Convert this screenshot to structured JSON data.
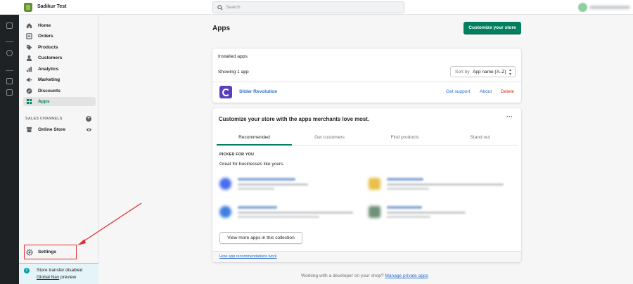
{
  "topbar": {
    "store_name": "Sadikur Test",
    "search_placeholder": "Search"
  },
  "sidebar": {
    "items": [
      {
        "label": "Home",
        "icon": "home-icon"
      },
      {
        "label": "Orders",
        "icon": "orders-icon"
      },
      {
        "label": "Products",
        "icon": "tag-icon"
      },
      {
        "label": "Customers",
        "icon": "person-icon"
      },
      {
        "label": "Analytics",
        "icon": "bar-chart-icon"
      },
      {
        "label": "Marketing",
        "icon": "megaphone-icon"
      },
      {
        "label": "Discounts",
        "icon": "discount-icon"
      },
      {
        "label": "Apps",
        "icon": "apps-icon",
        "active": true
      }
    ],
    "channels_title": "SALES CHANNELS",
    "online_store": "Online Store",
    "settings": "Settings",
    "transfer_line1": "Store transfer disabled",
    "transfer_link": "Global Nav",
    "transfer_suffix": " preview"
  },
  "main": {
    "title": "Apps",
    "customize_button": "Customize your store",
    "installed": {
      "title": "Installed apps",
      "showing": "Showing 1 app",
      "sort_label": "Sort by",
      "sort_value": "App name (A–Z)",
      "app_name": "Slider Revolution",
      "get_support": "Get support",
      "about": "About",
      "delete": "Delete"
    },
    "recommend": {
      "heading": "Customize your store with the apps merchants love most.",
      "tabs": [
        "Recommended",
        "Get customers",
        "Find products",
        "Stand out"
      ],
      "picked": "PICKED FOR YOU",
      "great": "Great for businesses like yours.",
      "view_more": "View more apps in this collection",
      "how_link": "How app recommendations work"
    },
    "footer_text": "Working with a developer on your shop?",
    "footer_link": "Manage private apps"
  },
  "colors": {
    "primary": "#008060",
    "link": "#2c6ecb",
    "danger": "#d72c0d",
    "annotation": "#e52c2c"
  }
}
